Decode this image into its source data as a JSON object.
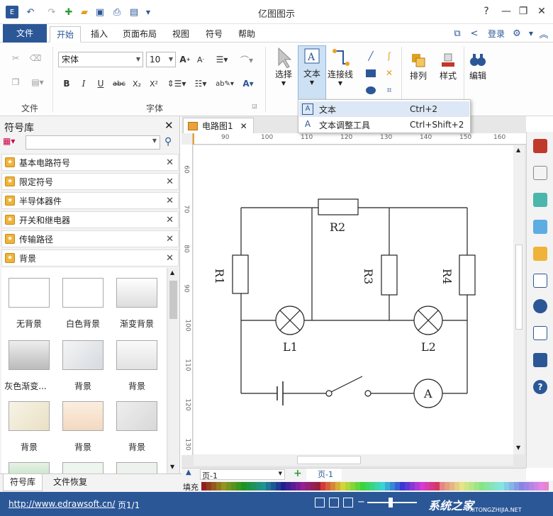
{
  "title": "亿图图示",
  "menu": {
    "file": "文件",
    "tabs": [
      "开始",
      "插入",
      "页面布局",
      "视图",
      "符号",
      "帮助"
    ],
    "login": "登录"
  },
  "ribbon": {
    "groups": {
      "file": "文件",
      "font": "字体"
    },
    "font_name": "宋体",
    "font_size": "10",
    "buttons": {
      "select": "选择",
      "text": "文本",
      "connector": "连接线",
      "arrange": "排列",
      "style": "样式",
      "edit": "编辑"
    }
  },
  "dropdown": {
    "items": [
      {
        "label": "文本",
        "shortcut": "Ctrl+2"
      },
      {
        "label": "文本调整工具",
        "shortcut": "Ctrl+Shift+2"
      }
    ]
  },
  "left_panel": {
    "title": "符号库",
    "search_placeholder": "",
    "libraries": [
      "基本电路符号",
      "限定符号",
      "半导体器件",
      "开关和继电器",
      "传输路径",
      "背景"
    ],
    "thumbs": [
      "无背景",
      "白色背景",
      "渐变背景",
      "灰色渐变...",
      "背景",
      "背景",
      "背景",
      "背景",
      "背景"
    ]
  },
  "doc_tab": "电路图1",
  "ruler": {
    "h": [
      "90",
      "100",
      "110",
      "120",
      "130",
      "140",
      "150",
      "160"
    ],
    "v": [
      "60",
      "70",
      "80",
      "90",
      "100",
      "110",
      "120",
      "130"
    ]
  },
  "circuit": {
    "labels": [
      "R2",
      "R1",
      "R3",
      "R4",
      "L1",
      "L2",
      "A"
    ]
  },
  "pagebar": {
    "page_select": "页-1",
    "page_tab": "页-1"
  },
  "fill_label": "填充",
  "bottom_tabs": [
    "符号库",
    "文件恢复"
  ],
  "status": {
    "url": "http://www.edrawsoft.cn/",
    "page": "页1/1",
    "watermark": "系统之家",
    "watermark_sub": "XITONGZHIJIA.NET"
  }
}
